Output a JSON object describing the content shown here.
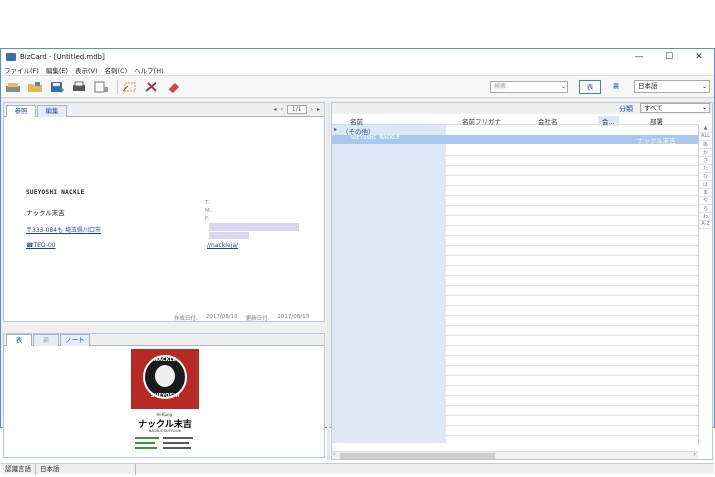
{
  "window": {
    "title": "BizCard - [Untitled.mdb]",
    "minimize": "—",
    "maximize": "☐",
    "close": "✕"
  },
  "menu": [
    "ファイル(F)",
    "編集(E)",
    "表示(V)",
    "名刺(C)",
    "ヘルプ(H)"
  ],
  "toolbar": {
    "search_placeholder": "検索",
    "view_front": "表",
    "view_back": "裏",
    "language": "日本語"
  },
  "card_panel": {
    "tabs": [
      "参照",
      "編集"
    ],
    "page": "1/1",
    "name_en": "SUEYOSHI NACKLE",
    "person": "ナックル末吉",
    "address": "〒333-084も 埼玉県川口市",
    "tel": "☎TEO-00",
    "label_t": "T.",
    "label_m": "M.",
    "label_f": "F.",
    "url": "//nackleja/",
    "created_label": "作成日付:",
    "created": "2017/08/13",
    "updated_label": "更新日付:",
    "updated": "2017/08/13"
  },
  "image_panel": {
    "tabs": [
      "表",
      "裏",
      "ノート"
    ],
    "logo_top": "NACKLE",
    "logo_bottom": "SUEYOSHI",
    "brand_small": "Hi-Kung-",
    "brand": "ナックル末吉",
    "brand_en": "NACKLE SUEYOSHI"
  },
  "list_panel": {
    "category_label": "分類",
    "category_value": "すべて",
    "columns": [
      "名前",
      "名前フリガナ",
      "会社名",
      "会...",
      "部署"
    ],
    "group": "（その他）",
    "rows": [
      {
        "name": "SUEYOSHI NACKLE",
        "department": "ナックル末吉"
      }
    ],
    "index": [
      "▲",
      "ALL",
      "あ",
      "か",
      "さ",
      "た",
      "な",
      "は",
      "ま",
      "や",
      "ら",
      "わ",
      "A-Z"
    ]
  },
  "status": {
    "lang_label": "認識言語",
    "lang": "日本語"
  },
  "colors": {
    "accent": "#3c7fd9",
    "selection": "#a9c8ee",
    "list_bg": "#dde8f4",
    "logo_red": "#b72a24"
  }
}
